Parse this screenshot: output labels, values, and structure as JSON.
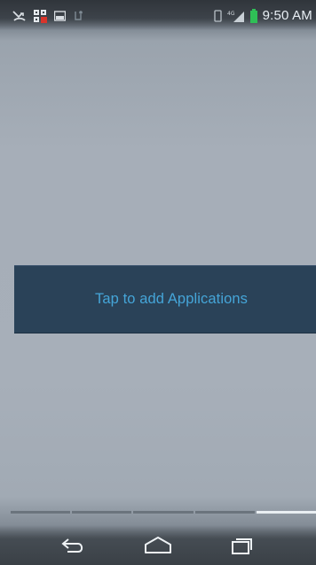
{
  "status_bar": {
    "time": "9:50 AM",
    "left_icons": [
      "missed-call-icon",
      "qr-app-icon",
      "photo-notification-icon",
      "usb-debug-icon"
    ],
    "right_icons": [
      "vibrate-icon",
      "signal-icon",
      "battery-icon"
    ]
  },
  "home": {
    "add_apps_label": "Tap to add Applications"
  },
  "page_indicator": {
    "page_count": 5,
    "active_page": 5
  },
  "nav_bar": {
    "buttons": [
      "back-icon",
      "home-icon",
      "recent-apps-icon"
    ]
  },
  "colors": {
    "wallpaper": "#a6aeb8",
    "panel": "#2a4258",
    "panel_text": "#45a5d8",
    "status_text": "#e8eef4"
  }
}
